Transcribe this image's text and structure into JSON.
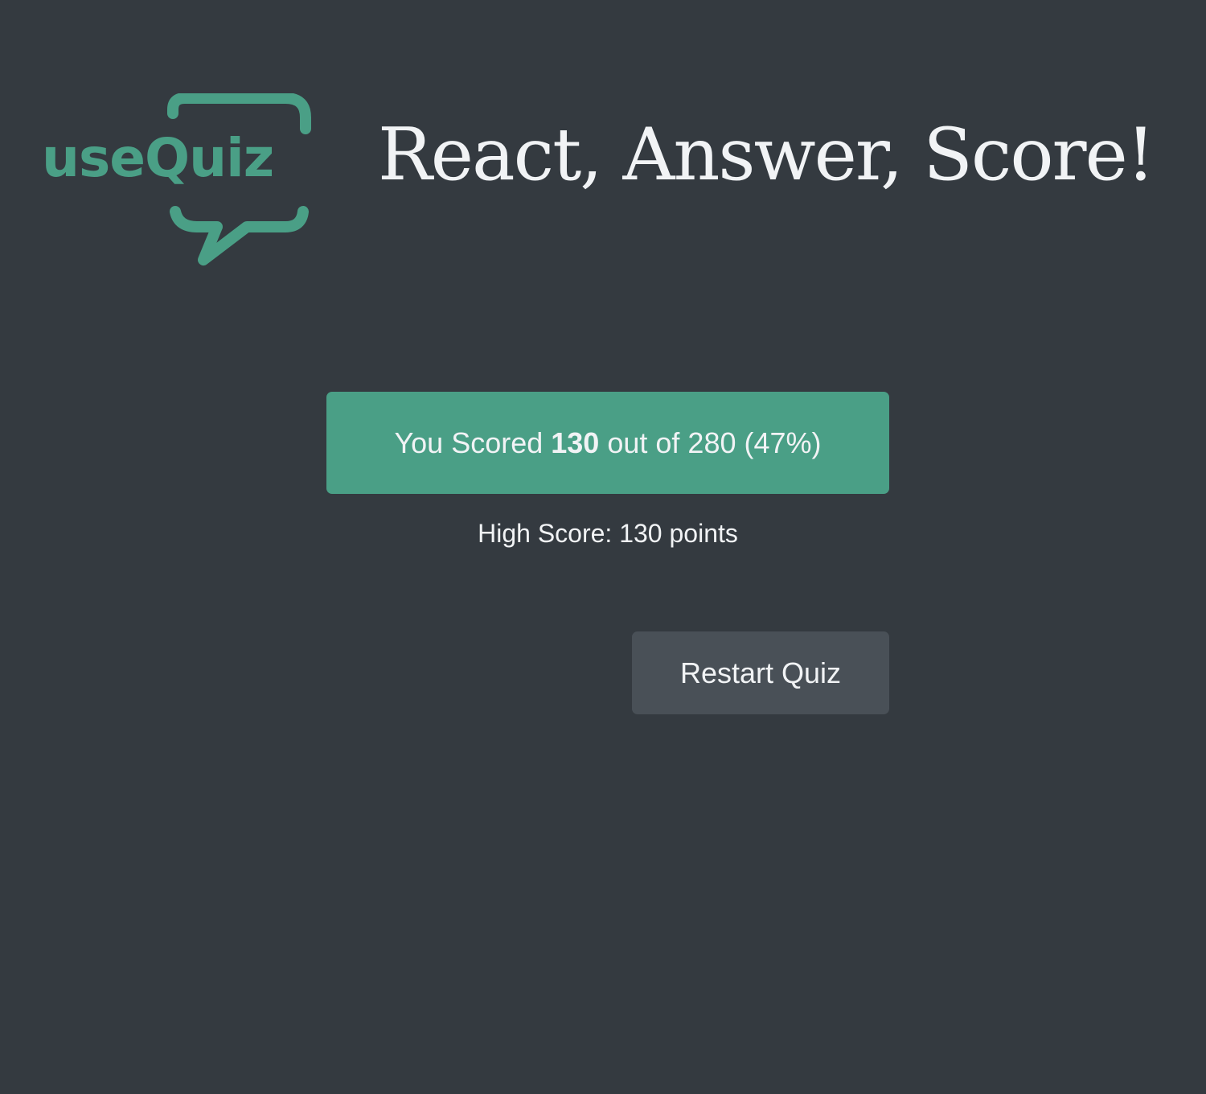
{
  "header": {
    "logo_text": "useQuiz",
    "title": "React, Answer, Score!"
  },
  "result": {
    "prefix": "You Scored ",
    "score": "130",
    "middle": " out of ",
    "max": "280",
    "percent": "(47%)"
  },
  "highscore": {
    "text": "High Score: 130 points"
  },
  "actions": {
    "restart_label": "Restart Quiz"
  },
  "colors": {
    "background": "#343a40",
    "accent": "#4a9f86",
    "text": "#f1f3f5",
    "button": "#495057"
  }
}
